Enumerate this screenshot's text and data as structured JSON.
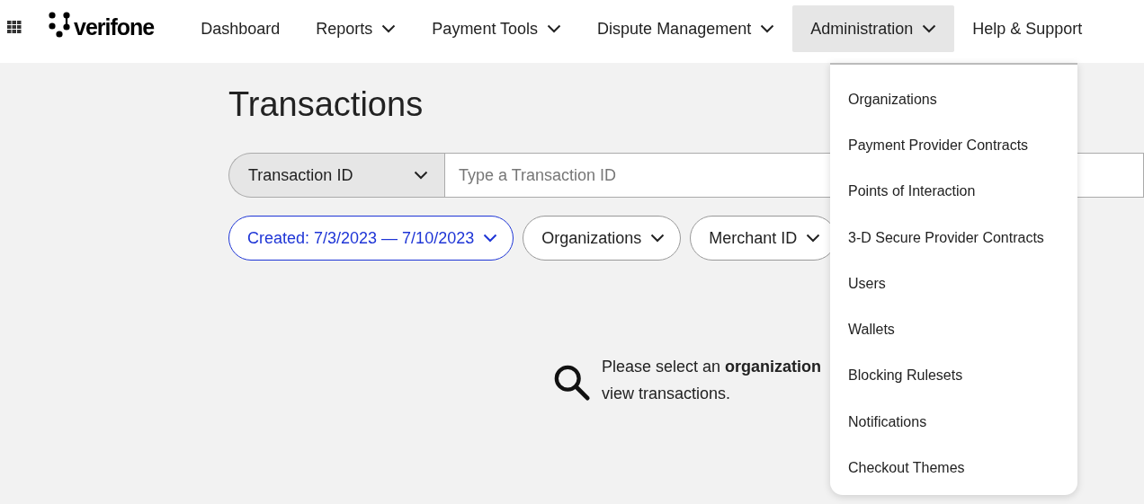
{
  "nav": {
    "logo": "verifone",
    "items": [
      {
        "label": "Dashboard",
        "dropdown": false,
        "selected": false
      },
      {
        "label": "Reports",
        "dropdown": true,
        "selected": false
      },
      {
        "label": "Payment Tools",
        "dropdown": true,
        "selected": false
      },
      {
        "label": "Dispute Management",
        "dropdown": true,
        "selected": false
      },
      {
        "label": "Administration",
        "dropdown": true,
        "selected": true
      },
      {
        "label": "Help & Support",
        "dropdown": false,
        "selected": false
      }
    ]
  },
  "page": {
    "title": "Transactions",
    "search": {
      "type": "Transaction ID",
      "placeholder": "Type a Transaction ID"
    },
    "filters": [
      {
        "label": "Created: 7/3/2023 — 7/10/2023",
        "active": true
      },
      {
        "label": "Organizations",
        "active": false
      },
      {
        "label": "Merchant ID",
        "active": false
      }
    ],
    "message": [
      "Please select an **organization**",
      "view transactions."
    ]
  },
  "menu": {
    "items": [
      "Organizations",
      "Payment Provider Contracts",
      "Points of Interaction",
      "3-D Secure Provider Contracts",
      "Users",
      "Wallets",
      "Blocking Rulesets",
      "Notifications",
      "Checkout Themes"
    ]
  }
}
